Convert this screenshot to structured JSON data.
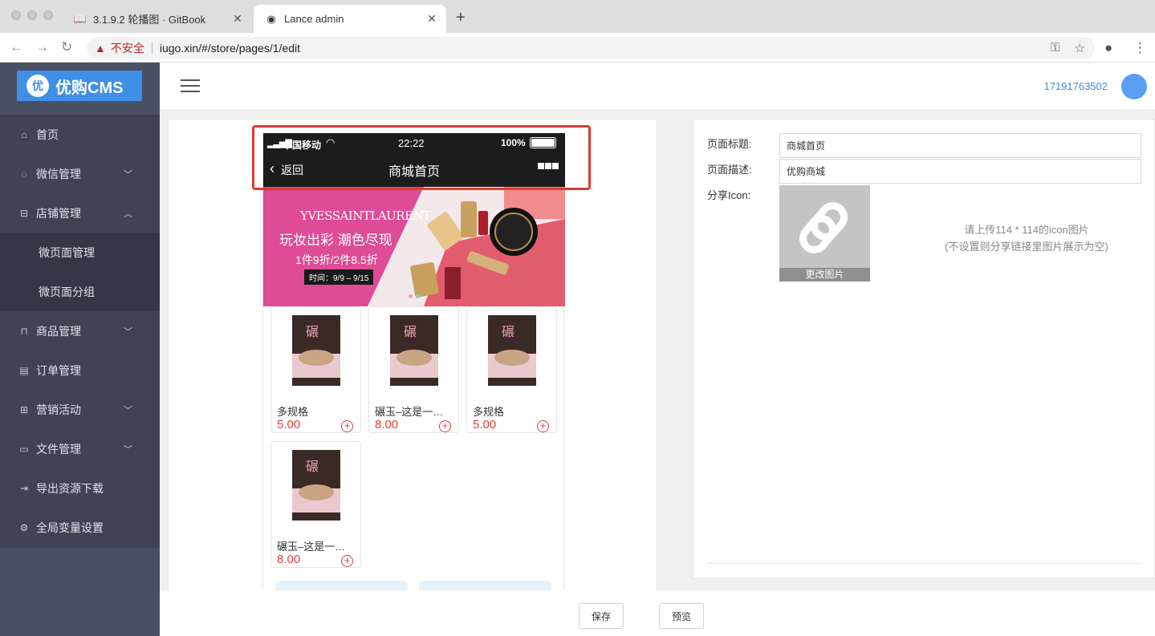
{
  "browser": {
    "tabs": [
      {
        "title": "3.1.9.2 轮播图 · GitBook",
        "icon": "book-icon"
      },
      {
        "title": "Lance admin",
        "icon": "globe-icon"
      }
    ],
    "security_label": "不安全",
    "url": "iugo.xin/#/store/pages/1/edit"
  },
  "sidebar": {
    "logo_text": "优购CMS",
    "logo_badge": "优",
    "items": [
      {
        "label": "首页",
        "icon": "home-icon"
      },
      {
        "label": "微信管理",
        "icon": "wechat-icon"
      },
      {
        "label": "店铺管理",
        "icon": "store-icon"
      },
      {
        "label": "微页面管理"
      },
      {
        "label": "微页面分组"
      },
      {
        "label": "商品管理",
        "icon": "bag-icon"
      },
      {
        "label": "订单管理",
        "icon": "clipboard-icon"
      },
      {
        "label": "营销活动",
        "icon": "gift-icon"
      },
      {
        "label": "文件管理",
        "icon": "folder-icon"
      },
      {
        "label": "导出资源下载",
        "icon": "export-icon"
      },
      {
        "label": "全局变量设置",
        "icon": "settings-icon"
      }
    ]
  },
  "header": {
    "user": "17191763502"
  },
  "phone": {
    "carrier": "中国移动",
    "time": "22:22",
    "battery": "100%",
    "back": "返回",
    "title": "商城首页",
    "banner": {
      "brand": "YVESSAINTLAURENT",
      "headline": "玩妆出彩  潮色尽现",
      "offer": "1件9折/2件8.5折",
      "date": "时间：9/9 – 9/15"
    },
    "products": [
      {
        "name": "多规格",
        "price": "5.00"
      },
      {
        "name": "碾玉–这是一本书",
        "price": "8.00"
      },
      {
        "name": "多规格",
        "price": "5.00"
      },
      {
        "name": "碾玉–这是一本书",
        "price": "8.00"
      }
    ]
  },
  "form": {
    "title_label": "页面标题:",
    "title_value": "商城首页",
    "desc_label": "页面描述:",
    "desc_value": "优购商城",
    "icon_label": "分享Icon:",
    "change_image": "更改图片",
    "hint_line1": "请上传114 * 114的icon图片",
    "hint_line2": "(不设置则分享链接里图片展示为空)"
  },
  "footer": {
    "save": "保存",
    "preview": "预览"
  }
}
